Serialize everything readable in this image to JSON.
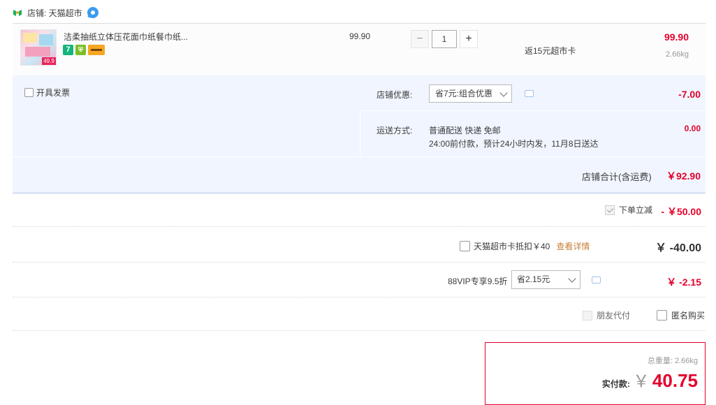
{
  "store": {
    "label": "店铺: 天猫超市"
  },
  "item": {
    "title": "洁柔抽纸立体压花面巾纸餐巾纸...",
    "thumb_tag": "49.9",
    "badge_seven": "7",
    "unit_price": "99.90",
    "quantity": "1",
    "rebate": "返15元超市卡",
    "total": "99.90",
    "weight": "2.66kg"
  },
  "panel": {
    "invoice_label": "开具发票",
    "discount_label": "店铺优惠:",
    "discount_option": "省7元:组合优惠",
    "discount_amount": "-7.00",
    "shipping_label": "运送方式:",
    "shipping_line1": "普通配送 快递 免邮",
    "shipping_line2": "24:00前付款，预计24小时内发，11月8日送达",
    "shipping_amount": "0.00",
    "store_total_label": "店铺合计(含运费)",
    "store_total_amount": "￥92.90"
  },
  "summary": {
    "order_discount_label": "下单立减",
    "order_discount_amount": "- ￥50.00",
    "card_label": "天猫超市卡抵扣￥40",
    "card_link": "查看详情",
    "card_amount": "￥ -40.00",
    "vip_label": "88VIP专享9.5折",
    "vip_option": "省2.15元",
    "vip_amount": "￥ -2.15",
    "friend_pay": "朋友代付",
    "anonymous": "匿名购买"
  },
  "pay": {
    "weight_label": "总重量:",
    "weight_value": "2.66kg",
    "pay_label": "实付款:",
    "currency": "￥",
    "amount": "40.75"
  },
  "colors": {
    "price_red": "#e4002b",
    "panel_bg": "#f0f5ff",
    "link_orange": "#c9803a"
  }
}
